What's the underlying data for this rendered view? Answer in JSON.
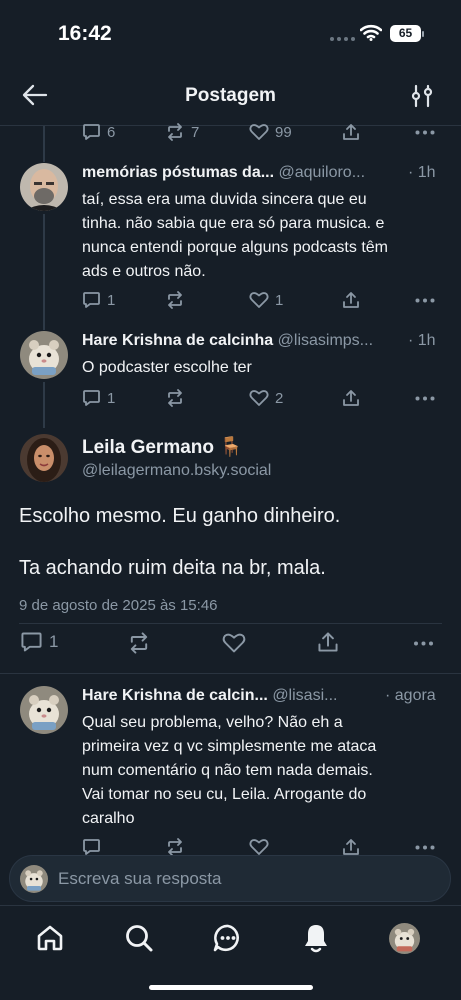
{
  "status_bar": {
    "time": "16:42",
    "battery": "65"
  },
  "header": {
    "title": "Postagem",
    "back_icon": "arrow-left-icon",
    "filter_icon": "sliders-icon"
  },
  "parent_actions": {
    "replies": "6",
    "reposts": "7",
    "likes": "99"
  },
  "replies_above": [
    {
      "display_name": "memórias póstumas da...",
      "handle": "@aquiloro...",
      "time": "· 1h",
      "lines": [
        "taí, essa era uma duvida sincera que eu",
        "tinha. não sabia que era só para musica. e",
        "nunca entendi porque alguns podcasts têm",
        "ads e outros não."
      ],
      "replies": "1",
      "likes": "1"
    },
    {
      "display_name": "Hare Krishna de calcinha",
      "handle": "@lisasimps...",
      "time": "· 1h",
      "lines": [
        "O podcaster escolhe ter"
      ],
      "replies": "1",
      "likes": "2"
    }
  ],
  "focused_post": {
    "display_name": "Leila Germano",
    "emoji": "🪑",
    "handle": "@leilagermano.bsky.social",
    "paragraph_1": "Escolho mesmo. Eu ganho dinheiro.",
    "paragraph_2": "Ta achando ruim deita na br, mala.",
    "timestamp": "9 de agosto de 2025 às 15:46",
    "replies": "1"
  },
  "reply_below": {
    "display_name": "Hare Krishna de calcin...",
    "handle": "@lisasi...",
    "time": "· agora",
    "lines": [
      "Qual seu problema, velho? Não eh a",
      "primeira vez q vc simplesmente me ataca",
      "num comentário q não tem nada demais.",
      "Vai tomar no seu cu, Leila. Arrogante do",
      "caralho"
    ]
  },
  "composer": {
    "placeholder": "Escreva sua resposta"
  },
  "tabbar": [
    "home-icon",
    "search-icon",
    "chat-icon",
    "bell-icon",
    "profile-avatar"
  ],
  "colors": {
    "background": "#161e27",
    "muted": "#8b98a5",
    "divider": "#2a3440"
  }
}
